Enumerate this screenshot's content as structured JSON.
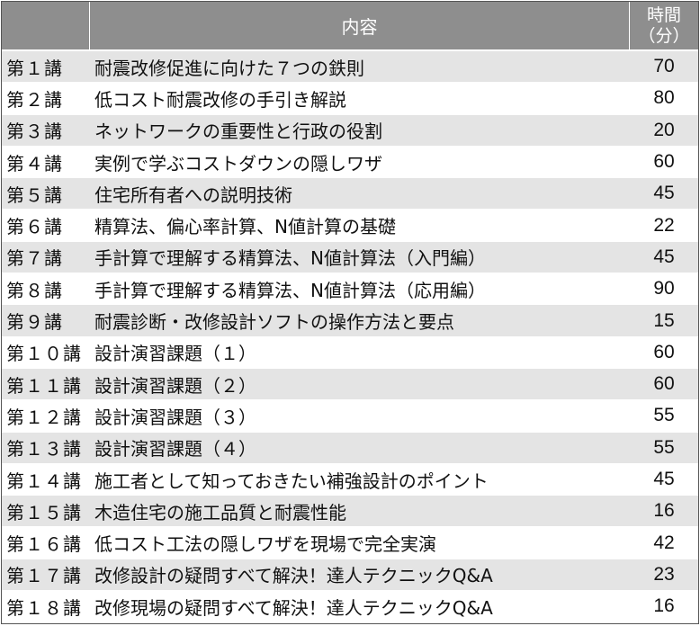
{
  "header": {
    "title_col": "内容",
    "time_col_line1": "時間",
    "time_col_line2": "（分）"
  },
  "rows": [
    {
      "no": "第１講",
      "title": "耐震改修促進に向けた７つの鉄則",
      "time": "70"
    },
    {
      "no": "第２講",
      "title": "低コスト耐震改修の手引き解説",
      "time": "80"
    },
    {
      "no": "第３講",
      "title": "ネットワークの重要性と行政の役割",
      "time": "20"
    },
    {
      "no": "第４講",
      "title": "実例で学ぶコストダウンの隠しワザ",
      "time": "60"
    },
    {
      "no": "第５講",
      "title": "住宅所有者への説明技術",
      "time": "45"
    },
    {
      "no": "第６講",
      "title": "精算法、偏心率計算、N値計算の基礎",
      "time": "22"
    },
    {
      "no": "第７講",
      "title": "手計算で理解する精算法、N値計算法（入門編）",
      "time": "45"
    },
    {
      "no": "第８講",
      "title": "手計算で理解する精算法、N値計算法（応用編）",
      "time": "90"
    },
    {
      "no": "第９講",
      "title": "耐震診断・改修設計ソフトの操作方法と要点",
      "time": "15"
    },
    {
      "no": "第１０講",
      "title": "設計演習課題（１）",
      "time": "60"
    },
    {
      "no": "第１１講",
      "title": "設計演習課題（２）",
      "time": "60"
    },
    {
      "no": "第１２講",
      "title": "設計演習課題（３）",
      "time": "55"
    },
    {
      "no": "第１３講",
      "title": "設計演習課題（４）",
      "time": "55"
    },
    {
      "no": "第１４講",
      "title": "施工者として知っておきたい補強設計のポイント",
      "time": "45"
    },
    {
      "no": "第１５講",
      "title": "木造住宅の施工品質と耐震性能",
      "time": "16"
    },
    {
      "no": "第１６講",
      "title": "低コスト工法の隠しワザを現場で完全実演",
      "time": "42"
    },
    {
      "no": "第１７講",
      "title": "改修設計の疑問すべて解決！達人テクニックQ&A",
      "time": "23"
    },
    {
      "no": "第１８講",
      "title": "改修現場の疑問すべて解決！達人テクニックQ&A",
      "time": "16"
    }
  ]
}
